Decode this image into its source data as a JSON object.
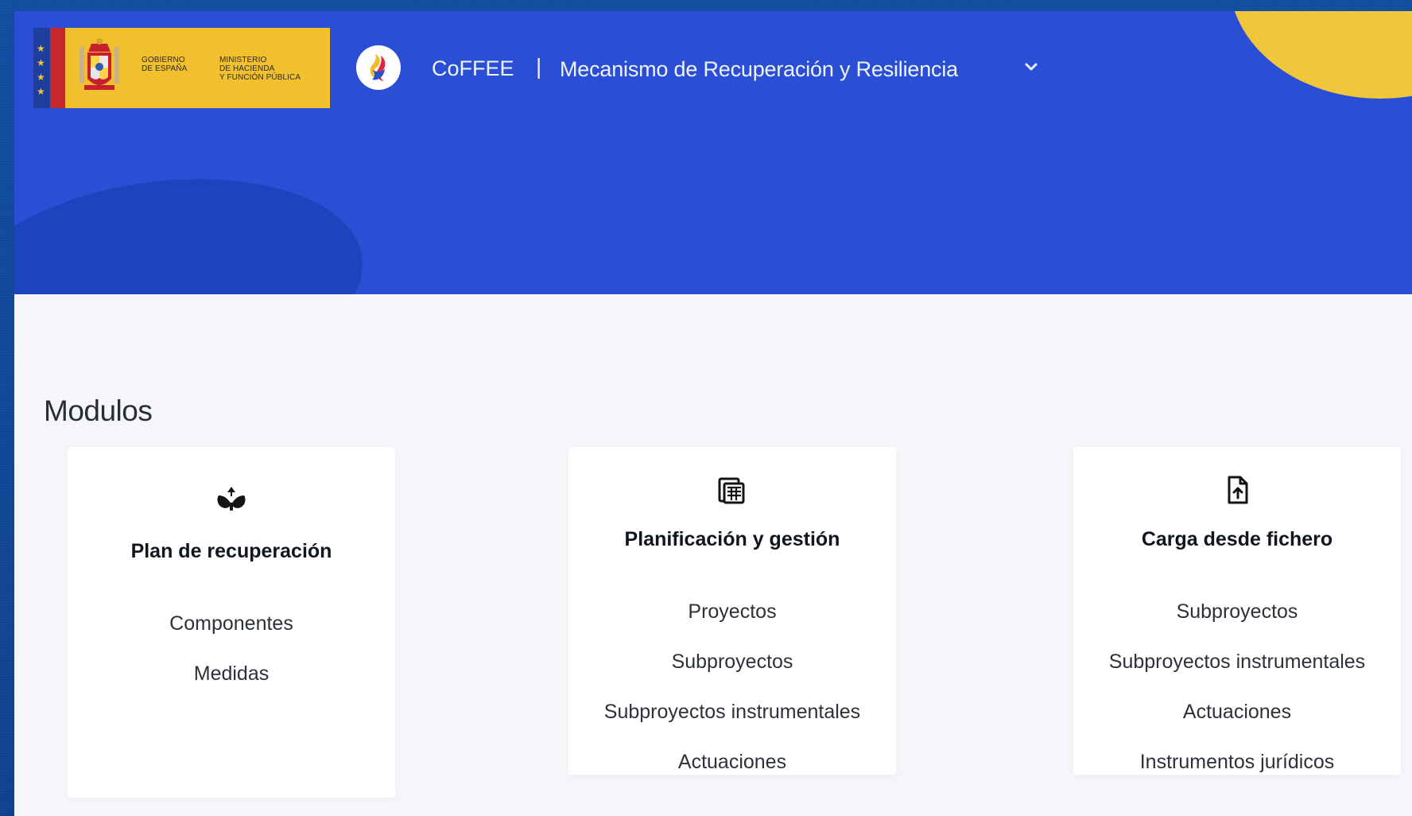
{
  "header": {
    "logo": {
      "line1": "GOBIERNO",
      "line2": "DE ESPAÑA",
      "ministry1": "MINISTERIO",
      "ministry2": "DE HACIENDA",
      "ministry3": "Y FUNCIÓN PÚBLICA"
    },
    "brand": {
      "name": "CoFFEE",
      "separator": "|",
      "subtitle": "Mecanismo de Recuperación y Resiliencia",
      "menu_icon": "chevron-down-icon"
    },
    "colors": {
      "primary_blue": "#2a4fd4",
      "accent_yellow": "#f0c73c"
    }
  },
  "main": {
    "section_title": "Modulos",
    "cards": [
      {
        "icon": "seedling-icon",
        "title": "Plan de recuperación",
        "links": [
          "Componentes",
          "Medidas"
        ]
      },
      {
        "icon": "table-stack-icon",
        "title": "Planificación y gestión",
        "links": [
          "Proyectos",
          "Subproyectos",
          "Subproyectos instrumentales",
          "Actuaciones"
        ]
      },
      {
        "icon": "file-upload-icon",
        "title": "Carga desde fichero",
        "links": [
          "Subproyectos",
          "Subproyectos instrumentales",
          "Actuaciones",
          "Instrumentos jurídicos"
        ]
      }
    ]
  }
}
